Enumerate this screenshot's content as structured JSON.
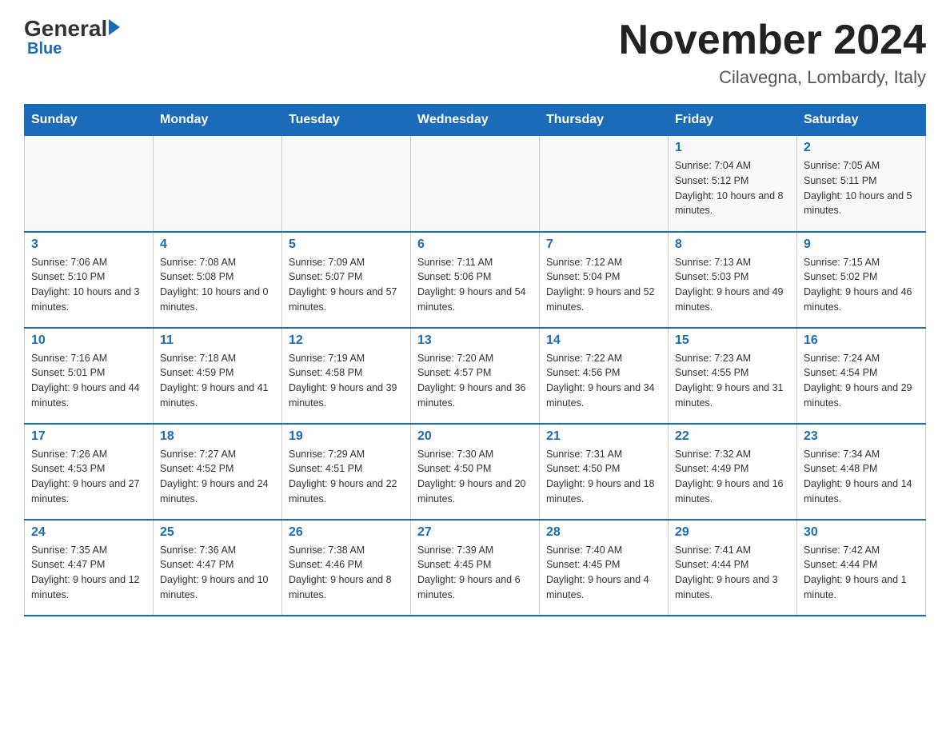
{
  "logo": {
    "general": "General",
    "blue": "Blue"
  },
  "header": {
    "month_year": "November 2024",
    "location": "Cilavegna, Lombardy, Italy"
  },
  "days_of_week": [
    "Sunday",
    "Monday",
    "Tuesday",
    "Wednesday",
    "Thursday",
    "Friday",
    "Saturday"
  ],
  "weeks": [
    {
      "days": [
        {
          "number": "",
          "info": ""
        },
        {
          "number": "",
          "info": ""
        },
        {
          "number": "",
          "info": ""
        },
        {
          "number": "",
          "info": ""
        },
        {
          "number": "",
          "info": ""
        },
        {
          "number": "1",
          "info": "Sunrise: 7:04 AM\nSunset: 5:12 PM\nDaylight: 10 hours and 8 minutes."
        },
        {
          "number": "2",
          "info": "Sunrise: 7:05 AM\nSunset: 5:11 PM\nDaylight: 10 hours and 5 minutes."
        }
      ]
    },
    {
      "days": [
        {
          "number": "3",
          "info": "Sunrise: 7:06 AM\nSunset: 5:10 PM\nDaylight: 10 hours and 3 minutes."
        },
        {
          "number": "4",
          "info": "Sunrise: 7:08 AM\nSunset: 5:08 PM\nDaylight: 10 hours and 0 minutes."
        },
        {
          "number": "5",
          "info": "Sunrise: 7:09 AM\nSunset: 5:07 PM\nDaylight: 9 hours and 57 minutes."
        },
        {
          "number": "6",
          "info": "Sunrise: 7:11 AM\nSunset: 5:06 PM\nDaylight: 9 hours and 54 minutes."
        },
        {
          "number": "7",
          "info": "Sunrise: 7:12 AM\nSunset: 5:04 PM\nDaylight: 9 hours and 52 minutes."
        },
        {
          "number": "8",
          "info": "Sunrise: 7:13 AM\nSunset: 5:03 PM\nDaylight: 9 hours and 49 minutes."
        },
        {
          "number": "9",
          "info": "Sunrise: 7:15 AM\nSunset: 5:02 PM\nDaylight: 9 hours and 46 minutes."
        }
      ]
    },
    {
      "days": [
        {
          "number": "10",
          "info": "Sunrise: 7:16 AM\nSunset: 5:01 PM\nDaylight: 9 hours and 44 minutes."
        },
        {
          "number": "11",
          "info": "Sunrise: 7:18 AM\nSunset: 4:59 PM\nDaylight: 9 hours and 41 minutes."
        },
        {
          "number": "12",
          "info": "Sunrise: 7:19 AM\nSunset: 4:58 PM\nDaylight: 9 hours and 39 minutes."
        },
        {
          "number": "13",
          "info": "Sunrise: 7:20 AM\nSunset: 4:57 PM\nDaylight: 9 hours and 36 minutes."
        },
        {
          "number": "14",
          "info": "Sunrise: 7:22 AM\nSunset: 4:56 PM\nDaylight: 9 hours and 34 minutes."
        },
        {
          "number": "15",
          "info": "Sunrise: 7:23 AM\nSunset: 4:55 PM\nDaylight: 9 hours and 31 minutes."
        },
        {
          "number": "16",
          "info": "Sunrise: 7:24 AM\nSunset: 4:54 PM\nDaylight: 9 hours and 29 minutes."
        }
      ]
    },
    {
      "days": [
        {
          "number": "17",
          "info": "Sunrise: 7:26 AM\nSunset: 4:53 PM\nDaylight: 9 hours and 27 minutes."
        },
        {
          "number": "18",
          "info": "Sunrise: 7:27 AM\nSunset: 4:52 PM\nDaylight: 9 hours and 24 minutes."
        },
        {
          "number": "19",
          "info": "Sunrise: 7:29 AM\nSunset: 4:51 PM\nDaylight: 9 hours and 22 minutes."
        },
        {
          "number": "20",
          "info": "Sunrise: 7:30 AM\nSunset: 4:50 PM\nDaylight: 9 hours and 20 minutes."
        },
        {
          "number": "21",
          "info": "Sunrise: 7:31 AM\nSunset: 4:50 PM\nDaylight: 9 hours and 18 minutes."
        },
        {
          "number": "22",
          "info": "Sunrise: 7:32 AM\nSunset: 4:49 PM\nDaylight: 9 hours and 16 minutes."
        },
        {
          "number": "23",
          "info": "Sunrise: 7:34 AM\nSunset: 4:48 PM\nDaylight: 9 hours and 14 minutes."
        }
      ]
    },
    {
      "days": [
        {
          "number": "24",
          "info": "Sunrise: 7:35 AM\nSunset: 4:47 PM\nDaylight: 9 hours and 12 minutes."
        },
        {
          "number": "25",
          "info": "Sunrise: 7:36 AM\nSunset: 4:47 PM\nDaylight: 9 hours and 10 minutes."
        },
        {
          "number": "26",
          "info": "Sunrise: 7:38 AM\nSunset: 4:46 PM\nDaylight: 9 hours and 8 minutes."
        },
        {
          "number": "27",
          "info": "Sunrise: 7:39 AM\nSunset: 4:45 PM\nDaylight: 9 hours and 6 minutes."
        },
        {
          "number": "28",
          "info": "Sunrise: 7:40 AM\nSunset: 4:45 PM\nDaylight: 9 hours and 4 minutes."
        },
        {
          "number": "29",
          "info": "Sunrise: 7:41 AM\nSunset: 4:44 PM\nDaylight: 9 hours and 3 minutes."
        },
        {
          "number": "30",
          "info": "Sunrise: 7:42 AM\nSunset: 4:44 PM\nDaylight: 9 hours and 1 minute."
        }
      ]
    }
  ]
}
